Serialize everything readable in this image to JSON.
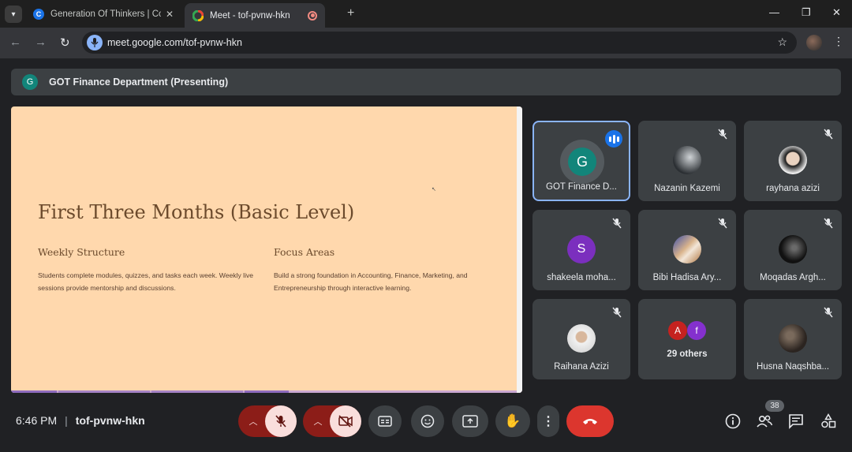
{
  "browser": {
    "tabs": [
      {
        "title": "Generation Of Thinkers | Cours",
        "favicon": "C"
      },
      {
        "title": "Meet - tof-pvnw-hkn"
      }
    ],
    "url": "meet.google.com/tof-pvnw-hkn"
  },
  "meet": {
    "presenting_initial": "G",
    "presenting_label": "GOT Finance Department (Presenting)",
    "slide": {
      "title": "First Three Months (Basic Level)",
      "col1_heading": "Weekly Structure",
      "col1_text": "Students complete modules, quizzes, and tasks each week. Weekly live sessions provide mentorship and discussions.",
      "col2_heading": "Focus Areas",
      "col2_text": "Build a strong foundation in Accounting, Finance, Marketing, and Entrepreneurship through interactive learning."
    },
    "participants": [
      {
        "name": "GOT Finance D...",
        "initial": "G"
      },
      {
        "name": "Nazanin Kazemi"
      },
      {
        "name": "rayhana azizi"
      },
      {
        "name": "shakeela moha...",
        "initial": "S"
      },
      {
        "name": "Bibi Hadisa Ary..."
      },
      {
        "name": "Moqadas Argh..."
      },
      {
        "name": "Raihana Azizi"
      },
      {
        "name": "29 others",
        "initials": [
          "A",
          "f"
        ]
      },
      {
        "name": "Husna Naqshba..."
      }
    ],
    "time": "6:46 PM",
    "meeting_code": "tof-pvnw-hkn",
    "people_count": "38"
  }
}
